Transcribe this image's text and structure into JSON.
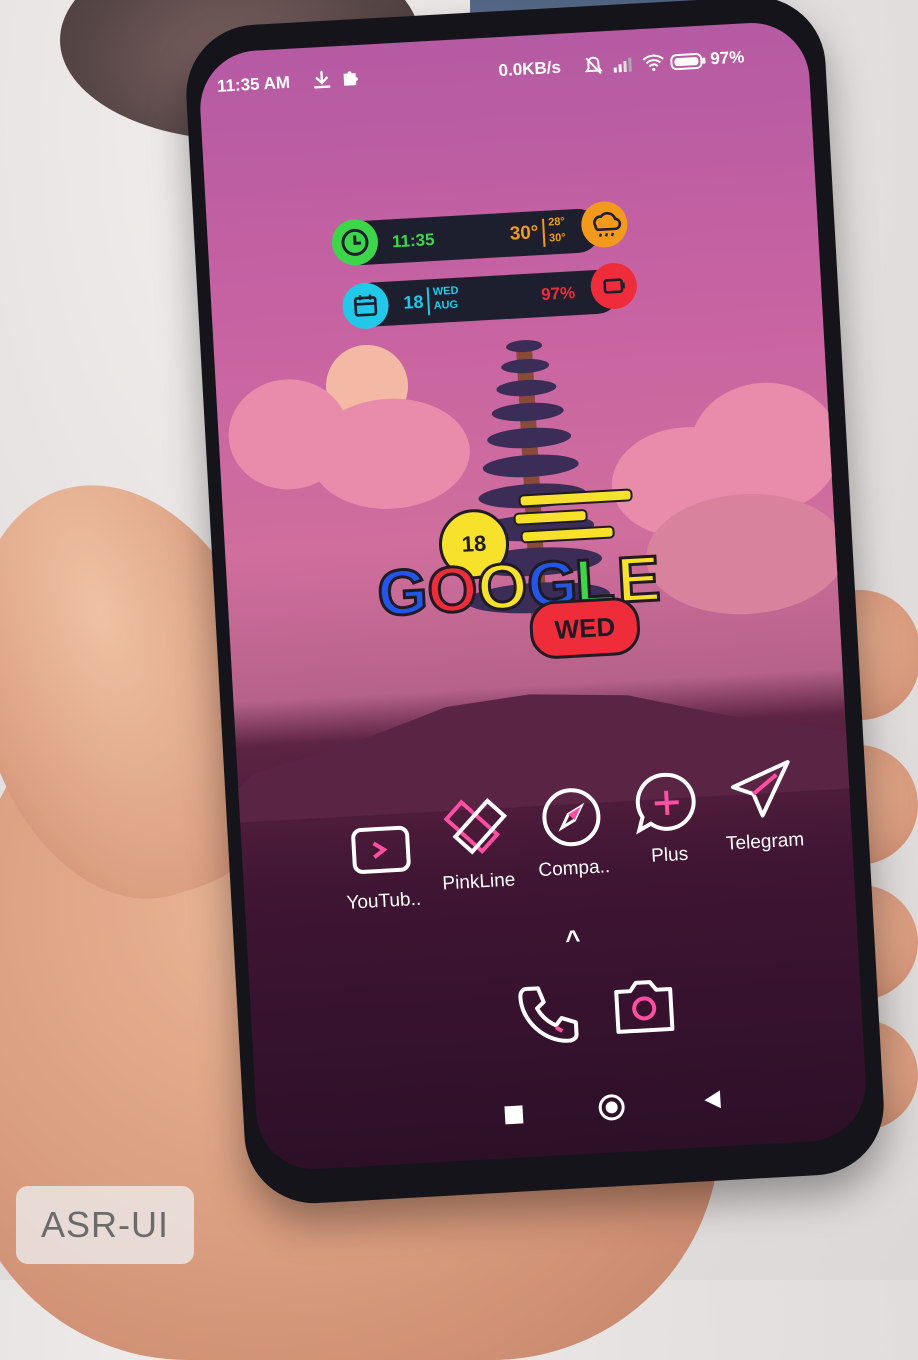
{
  "status_bar": {
    "time": "11:35 AM",
    "net_speed": "0.0KB/s",
    "battery": "97%"
  },
  "widget_time": {
    "time": "11:35",
    "temp": "30°",
    "high": "28°",
    "low": "30°"
  },
  "widget_date": {
    "day": "18",
    "weekday": "WED",
    "month": "AUG",
    "battery": "97%"
  },
  "google_widget": {
    "day": "18",
    "word": "GOOGLE",
    "weekday": "WED"
  },
  "apps": [
    {
      "label": "YouTub..",
      "icon": "youtube-icon"
    },
    {
      "label": "PinkLine",
      "icon": "pinkline-icon"
    },
    {
      "label": "Compa..",
      "icon": "compass-icon"
    },
    {
      "label": "Plus",
      "icon": "plus-icon"
    },
    {
      "label": "Telegram",
      "icon": "telegram-icon"
    }
  ],
  "dock": {
    "up": "^"
  },
  "watermark": "ASR-UI",
  "colors": {
    "pink_icon": "#ff4fa3",
    "green": "#3dd64b",
    "orange": "#f39a1d",
    "cyan": "#21c8e8",
    "red": "#ee2c3a"
  }
}
